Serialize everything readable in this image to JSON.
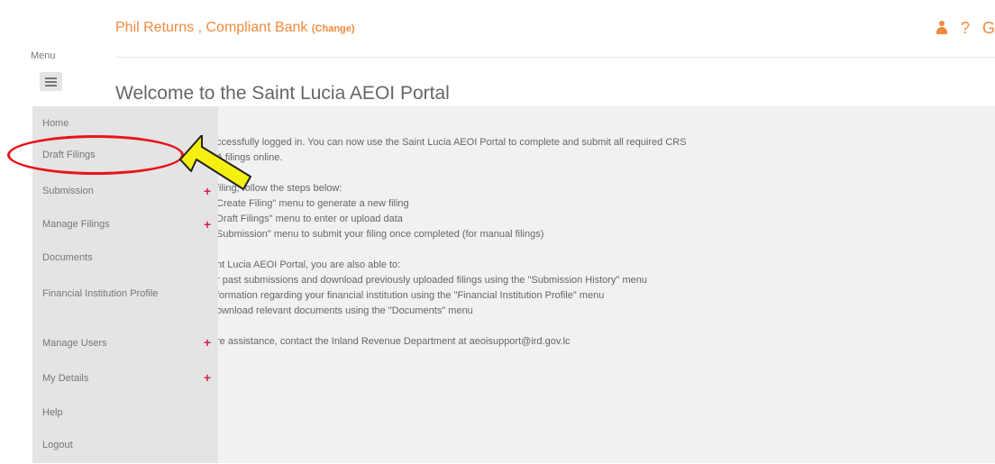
{
  "header": {
    "user_org": "Phil Returns , Compliant Bank",
    "change_link": "(Change)",
    "icons": [
      "user-icon",
      "help-icon",
      "logout-icon"
    ],
    "help_glyph": "?",
    "logout_glyph": "G"
  },
  "menu": {
    "label": "Menu",
    "items": [
      "Home",
      "Draft Filings",
      "Submission",
      "Manage Filings",
      "Documents",
      "Financial Institution Profile",
      "Manage Users",
      "My Details",
      "Help",
      "Logout"
    ]
  },
  "page": {
    "title": "Welcome to the Saint Lucia AEOI Portal"
  },
  "content": {
    "lines": [
      "ccessfully logged in. You can now use the Saint Lucia AEOI Portal to complete and submit all required CRS",
      "A filings online.",
      "",
      "filing, follow the steps below:",
      "Create Filing\" menu to generate a new filing",
      "Draft Filings\" menu to enter or upload data",
      "Submission\" menu to submit your filing once completed (for manual filings)",
      "",
      "nt Lucia AEOI Portal, you are also able to:",
      "r past submissions and download previously uploaded filings using the \"Submission History\" menu",
      "formation regarding your financial institution using the \"Financial Institution Profile\" menu",
      "ownload relevant documents using the \"Documents\" menu",
      "",
      "re assistance, contact the Inland Revenue Department at aeoisupport@ird.gov.lc"
    ]
  },
  "colors": {
    "accent": "#f08a3c",
    "plus": "#d9204f",
    "highlight": "#e8141a",
    "arrow": "#f5f010"
  }
}
